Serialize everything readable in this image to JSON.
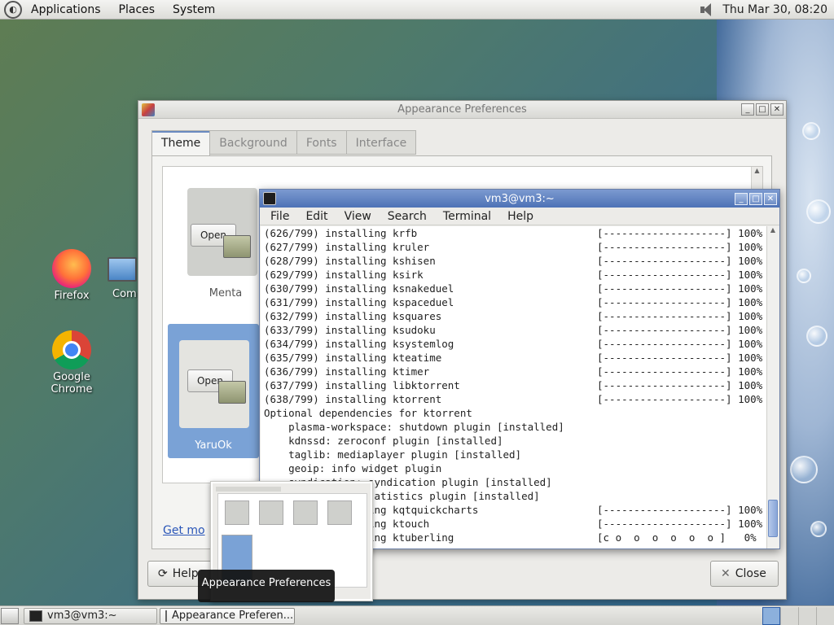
{
  "top_panel": {
    "menus": [
      "Applications",
      "Places",
      "System"
    ],
    "clock": "Thu Mar 30, 08:20",
    "icons": {
      "logo": "distro-logo-icon",
      "volume": "volume-icon"
    }
  },
  "desktop_icons": {
    "firefox": "Firefox",
    "computer": "Comp",
    "chrome": "Google Chrome"
  },
  "appearance": {
    "title": "Appearance Preferences",
    "tabs": [
      "Theme",
      "Background",
      "Fonts",
      "Interface"
    ],
    "themes": [
      {
        "name": "Menta",
        "open_label": "Open"
      },
      {
        "name": "YaruOk",
        "open_label": "Open"
      }
    ],
    "get_more": "Get mo",
    "help_label": "Help",
    "close_label": "Close"
  },
  "terminal": {
    "title": "vm3@vm3:~",
    "menu": [
      "File",
      "Edit",
      "View",
      "Search",
      "Terminal",
      "Help"
    ],
    "lines": [
      {
        "text": "(626/799) installing krfb",
        "bar": "[--------------------] 100%"
      },
      {
        "text": "(627/799) installing kruler",
        "bar": "[--------------------] 100%"
      },
      {
        "text": "(628/799) installing kshisen",
        "bar": "[--------------------] 100%"
      },
      {
        "text": "(629/799) installing ksirk",
        "bar": "[--------------------] 100%"
      },
      {
        "text": "(630/799) installing ksnakeduel",
        "bar": "[--------------------] 100%"
      },
      {
        "text": "(631/799) installing kspaceduel",
        "bar": "[--------------------] 100%"
      },
      {
        "text": "(632/799) installing ksquares",
        "bar": "[--------------------] 100%"
      },
      {
        "text": "(633/799) installing ksudoku",
        "bar": "[--------------------] 100%"
      },
      {
        "text": "(634/799) installing ksystemlog",
        "bar": "[--------------------] 100%"
      },
      {
        "text": "(635/799) installing kteatime",
        "bar": "[--------------------] 100%"
      },
      {
        "text": "(636/799) installing ktimer",
        "bar": "[--------------------] 100%"
      },
      {
        "text": "(637/799) installing libktorrent",
        "bar": "[--------------------] 100%"
      },
      {
        "text": "(638/799) installing ktorrent",
        "bar": "[--------------------] 100%"
      },
      {
        "text": "Optional dependencies for ktorrent",
        "bar": ""
      },
      {
        "text": "    plasma-workspace: shutdown plugin [installed]",
        "bar": ""
      },
      {
        "text": "    kdnssd: zeroconf plugin [installed]",
        "bar": ""
      },
      {
        "text": "    taglib: mediaplayer plugin [installed]",
        "bar": ""
      },
      {
        "text": "    geoip: info widget plugin",
        "bar": ""
      },
      {
        "text": "    syndication: syndication plugin [installed]",
        "bar": ""
      },
      {
        "text": "                  atistics plugin [installed]",
        "bar": ""
      },
      {
        "text": "                 ing kqtquickcharts",
        "bar": "[--------------------] 100%"
      },
      {
        "text": "                 ing ktouch",
        "bar": "[--------------------] 100%"
      },
      {
        "text": "                 ing ktuberling",
        "bar": "[c o  o  o  o  o  o ]   0%"
      }
    ]
  },
  "tooltip": "Appearance Preferences",
  "taskbar": {
    "tasks": [
      "vm3@vm3:~",
      "Appearance Preferen..."
    ]
  }
}
